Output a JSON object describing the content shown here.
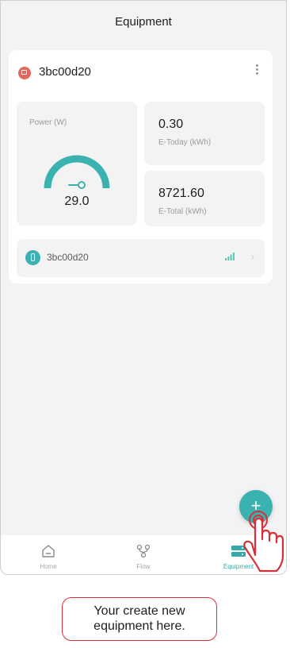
{
  "header": {
    "title": "Equipment"
  },
  "device": {
    "name": "3bc00d20",
    "power": {
      "label": "Power (W)",
      "value": "29.0",
      "gauge_fraction": 0.15
    },
    "today": {
      "value": "0.30",
      "label": "E-Today (kWh)"
    },
    "total": {
      "value": "8721.60",
      "label": "E-Total (kWh)"
    },
    "sub": {
      "name": "3bc00d20"
    }
  },
  "fab": {
    "symbol": "+"
  },
  "tabs": [
    {
      "label": "Home",
      "active": false
    },
    {
      "label": "Flow",
      "active": false
    },
    {
      "label": "Equipment",
      "active": true
    }
  ],
  "callout": {
    "line1": "Your create new",
    "line2": "equipment here."
  },
  "colors": {
    "accent": "#39b2b0",
    "device_icon": "#e0695f",
    "callout_border": "#d8303a",
    "background": "#f3f3f5"
  }
}
